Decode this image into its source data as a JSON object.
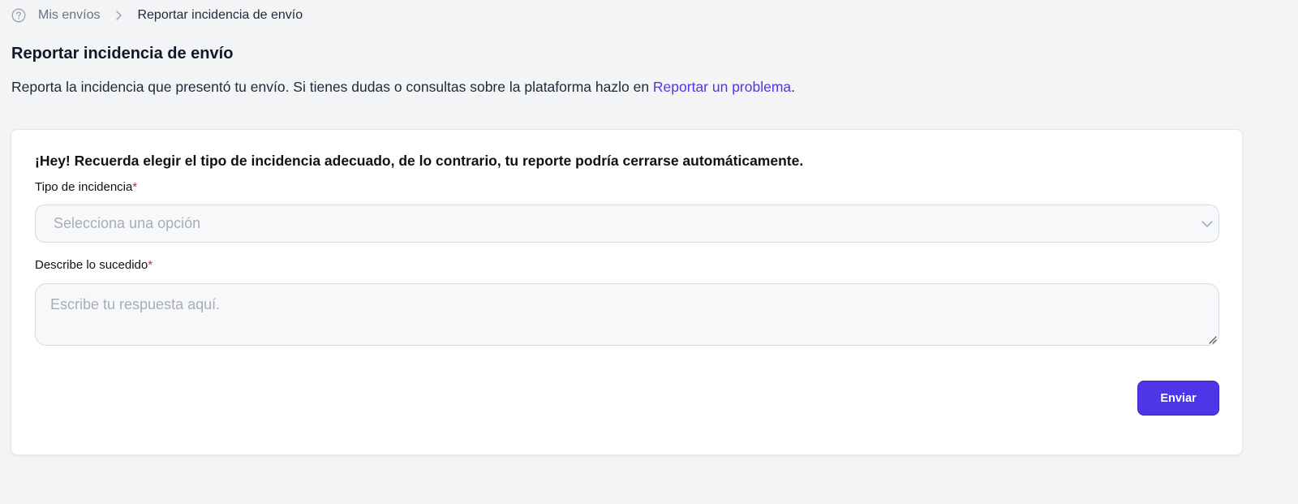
{
  "breadcrumb": {
    "help_icon": "help-circle-icon",
    "parent_label": "Mis envíos",
    "separator_icon": "chevron-right-icon",
    "current_label": "Reportar incidencia de envío"
  },
  "page": {
    "title": "Reportar incidencia de envío",
    "description_text": "Reporta la incidencia que presentó tu envío. Si tienes dudas o consultas sobre la plataforma hazlo en ",
    "description_link": "Reportar un problema",
    "description_end": "."
  },
  "form": {
    "notice": "¡Hey! Recuerda elegir el tipo de incidencia adecuado, de lo contrario, tu reporte podría cerrarse automáticamente.",
    "type_label": "Tipo de incidencia",
    "type_required_mark": "*",
    "type_placeholder": "Selecciona una opción",
    "type_chevron_icon": "chevron-down-icon",
    "description_label": "Describe lo sucedido",
    "description_required_mark": "*",
    "description_placeholder": "Escribe tu respuesta aquí.",
    "submit_label": "Enviar"
  },
  "colors": {
    "background": "#f3f4f6",
    "accent": "#4f35e8",
    "required": "#dc2626",
    "placeholder": "#a8adb5"
  }
}
